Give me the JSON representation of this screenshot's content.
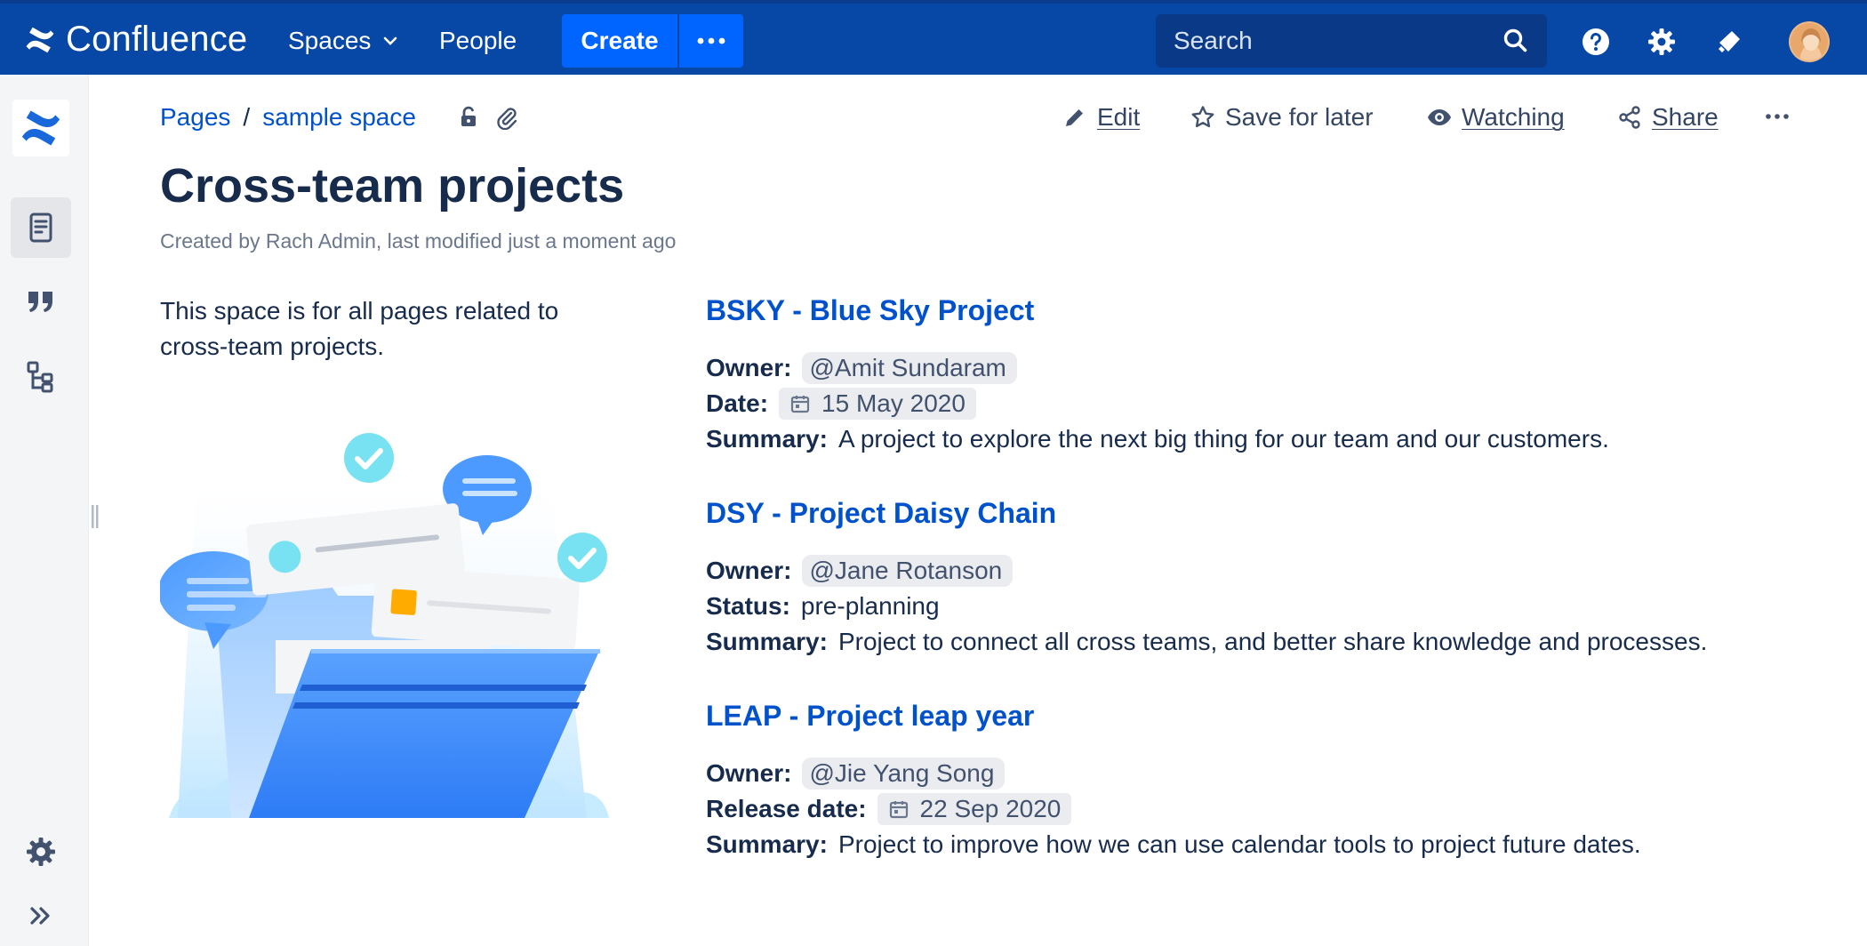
{
  "topnav": {
    "product_name": "Confluence",
    "spaces_label": "Spaces",
    "people_label": "People",
    "create_label": "Create",
    "search_placeholder": "Search",
    "brand_color": "#0747a6",
    "create_color": "#0065ff"
  },
  "sidebar": {
    "items": [
      {
        "name": "space-logo-icon"
      },
      {
        "name": "pages-icon",
        "active": true
      },
      {
        "name": "blog-quote-icon"
      },
      {
        "name": "page-tree-icon"
      },
      {
        "name": "space-settings-icon"
      },
      {
        "name": "expand-sidebar-icon"
      }
    ]
  },
  "breadcrumb": {
    "items": [
      "Pages",
      "sample space"
    ],
    "separator": "/"
  },
  "actions": {
    "edit": "Edit",
    "save_for_later": "Save for later",
    "watching": "Watching",
    "share": "Share"
  },
  "page": {
    "title": "Cross-team projects",
    "byline": "Created by Rach Admin, last modified just a moment ago",
    "intro": "This space is for all pages related to cross-team projects."
  },
  "projects": [
    {
      "title": "BSKY - Blue Sky Project",
      "owner_label": "Owner:",
      "owner": "@Amit Sundaram",
      "field_label": "Date:",
      "field_value": "15 May 2020",
      "summary_label": "Summary:",
      "summary": "A project to explore the next big thing for our team and our customers."
    },
    {
      "title": "DSY - Project Daisy Chain",
      "owner_label": "Owner:",
      "owner": "@Jane Rotanson",
      "field_label": "Status:",
      "field_value": "pre-planning",
      "summary_label": "Summary:",
      "summary": "Project to connect all cross teams, and better share knowledge and processes."
    },
    {
      "title": "LEAP - Project leap year",
      "owner_label": "Owner:",
      "owner": "@Jie Yang Song",
      "field_label": "Release date:",
      "field_value": "22 Sep 2020",
      "summary_label": "Summary:",
      "summary": "Project to improve how we can use calendar tools to project future dates."
    }
  ]
}
